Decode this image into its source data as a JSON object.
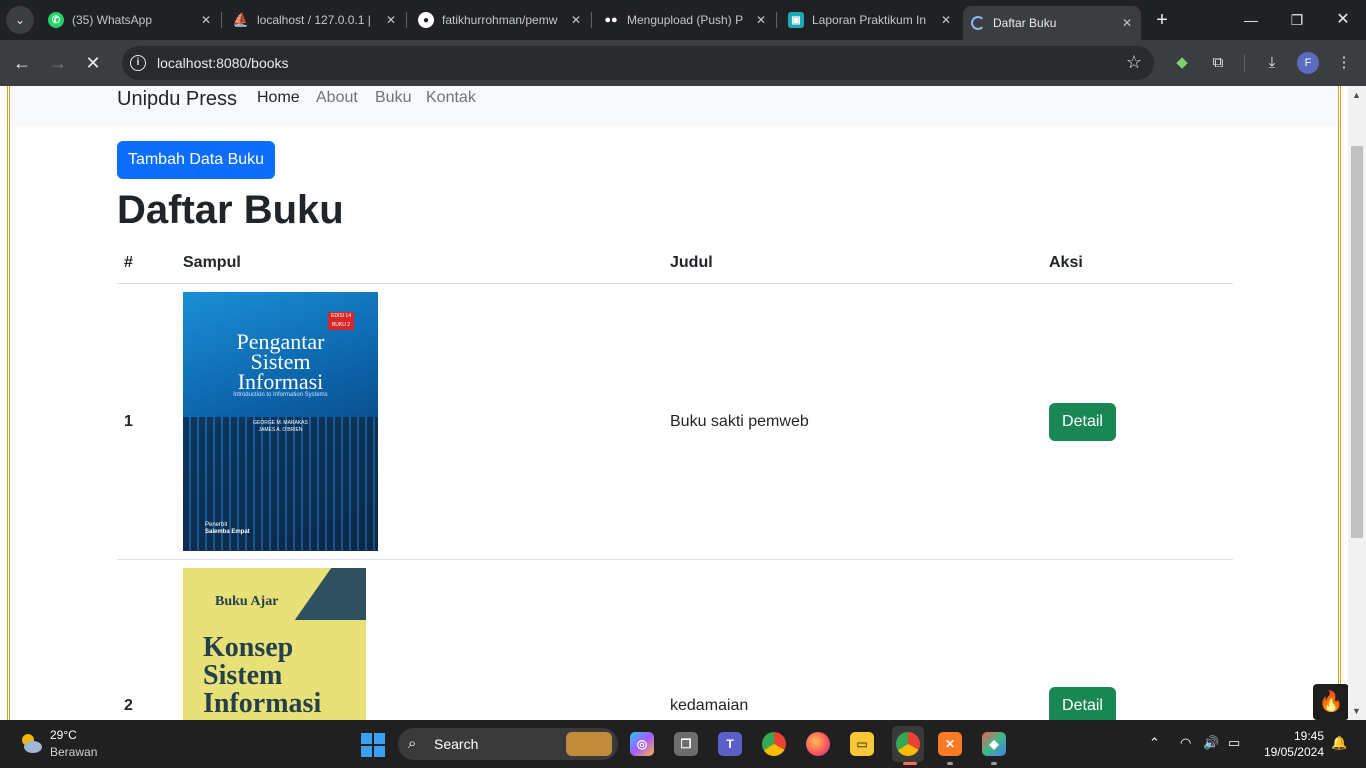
{
  "browser": {
    "tabs": [
      {
        "title": "(35) WhatsApp",
        "favicon": "whatsapp-icon",
        "color": "#25d366"
      },
      {
        "title": "localhost / 127.0.0.1 |",
        "favicon": "phpmyadmin-icon",
        "color": "#f29111"
      },
      {
        "title": "fatikhurrohman/pemw",
        "favicon": "github-icon",
        "color": "#ffffff"
      },
      {
        "title": "Mengupload (Push) P",
        "favicon": "medium-icon",
        "color": "#ffffff"
      },
      {
        "title": "Laporan Praktikum In",
        "favicon": "classroom-icon",
        "color": "#1fa9b8"
      },
      {
        "title": "Daftar Buku",
        "favicon": "loading-icon",
        "color": "#8ab4f8"
      }
    ],
    "url": "localhost:8080/books"
  },
  "site": {
    "brand": "Unipdu Press",
    "nav": [
      "Home",
      "About",
      "Buku",
      "Kontak"
    ]
  },
  "page": {
    "add_button": "Tambah Data Buku",
    "heading": "Daftar Buku",
    "columns": [
      "#",
      "Sampul",
      "Judul",
      "Aksi"
    ],
    "rows": [
      {
        "num": "1",
        "title": "Buku sakti pemweb",
        "action": "Detail",
        "cover": {
          "badge": "EDISI 14 BUKU 2",
          "lines": [
            "Pengantar",
            "Sistem",
            "Informasi"
          ],
          "subtitle": "Introduction to Information Systems",
          "authors": [
            "GEORGE M. MARAKAS",
            "JAMES A. O'BRIEN"
          ],
          "publisher": [
            "Penerbit",
            "Salemba Empat"
          ]
        }
      },
      {
        "num": "2",
        "title": "kedamaian",
        "action": "Detail",
        "cover": {
          "series": "Buku Ajar",
          "lines": [
            "Konsep",
            "Sistem",
            "Informasi"
          ]
        }
      }
    ]
  },
  "taskbar": {
    "temperature": "29°C",
    "condition": "Berawan",
    "search_label": "Search",
    "time": "19:45",
    "date": "19/05/2024"
  }
}
